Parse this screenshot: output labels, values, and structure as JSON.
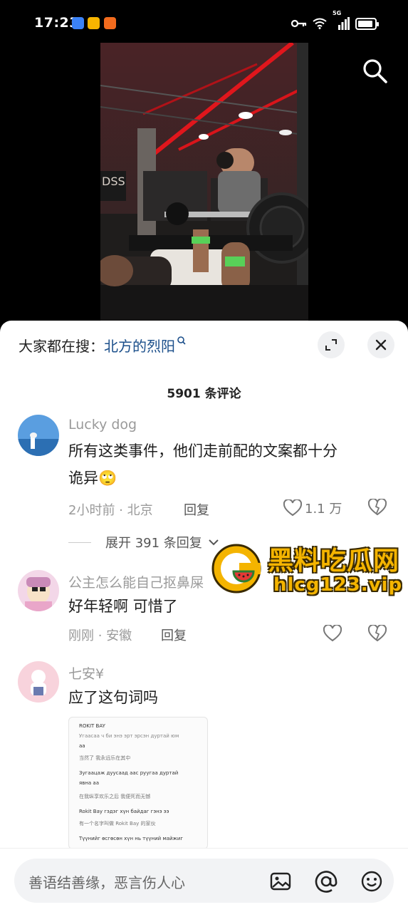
{
  "status_bar": {
    "time": "17:23",
    "network": "5G"
  },
  "hot_search": {
    "prefix": "大家都在搜：",
    "keyword": "北方的烈阳"
  },
  "comments_count": "5901 条评论",
  "comments": [
    {
      "username": "Lucky dog",
      "text_line1": "所有这类事件，他们走前配的文案都十分",
      "text_line2": "诡异",
      "emoji": "🙄",
      "time": "2小时前 · 北京",
      "reply": "回复",
      "likes": "1.1 万",
      "expand": "展开 391 条回复"
    },
    {
      "username": "公主怎么能自己抠鼻屎",
      "text": "好年轻啊 可惜了",
      "time": "刚刚 · 安徽",
      "reply": "回复"
    },
    {
      "username": "七安¥",
      "text": "应了这句词吗"
    }
  ],
  "attached_image_lines": [
    "ROKIT BAY",
    "Угаасаа ч би энэ эрт эрсэн дуртай юм",
    "аа",
    "当然了 我永远乐在其中",
    "Зугаацаж дуусаад аас руугаа дуртай",
    "явна аа",
    "在我纵享欢乐之后 我便死而无憾",
    "Rokit Bay гэдэг хүн байдаг гэнэ ээ",
    "有一个名字叫做 Rokit Bay 的家伙",
    "Түүнийг өсгөсөн хүн нь түүний майжиг"
  ],
  "watermark": {
    "title": "黑料吃瓜网",
    "url": "hlcg123.vip"
  },
  "input": {
    "placeholder": "善语结善缘，恶言伤人心"
  },
  "colors": {
    "link": "#1a4e8a",
    "watermark": "#f4b400"
  }
}
